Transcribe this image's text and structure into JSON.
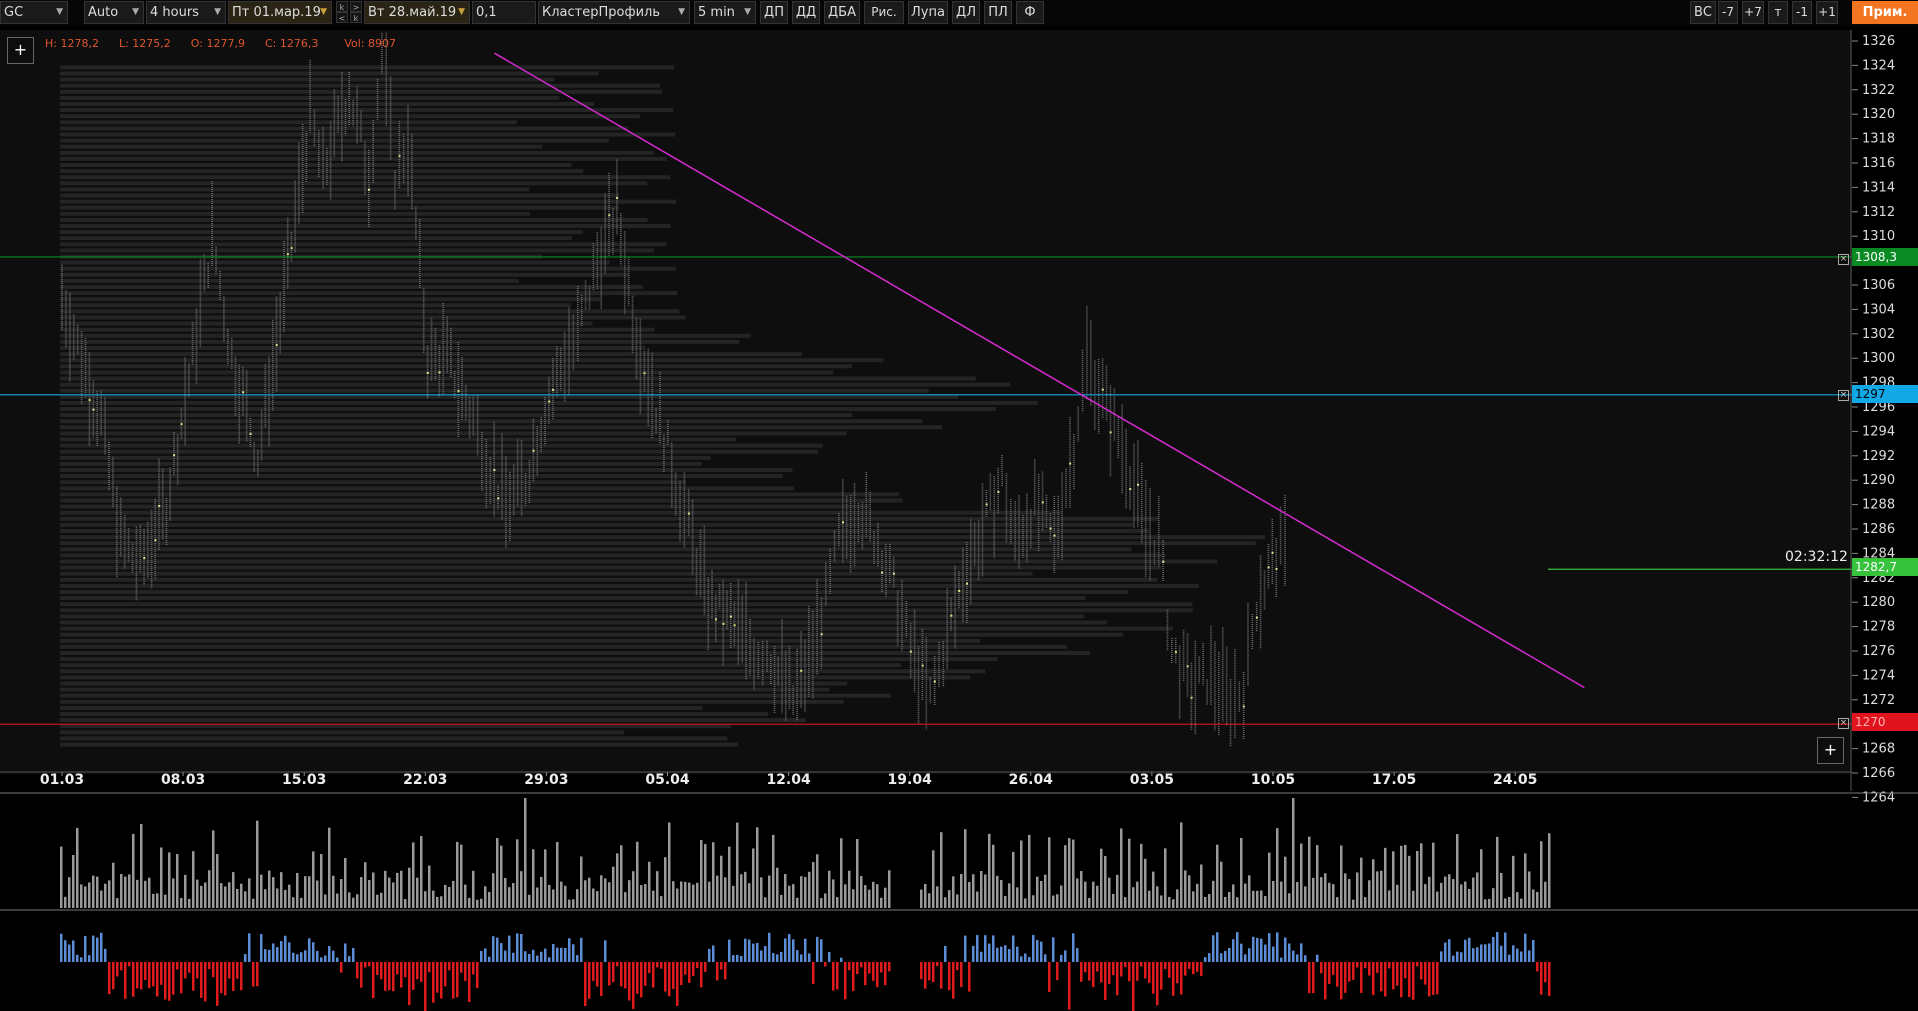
{
  "toolbar": {
    "symbol": "GC",
    "scale_mode": "Auto",
    "timeframe": "4 hours",
    "date_from": "Пт 01.мар.19",
    "date_to": "Вт 28.май.19",
    "tick_size": "0,1",
    "chart_type": "КластерПрофиль",
    "cluster_period": "5 min",
    "btn_dp": "ДП",
    "btn_dd": "ДД",
    "btn_dba": "ДБА",
    "btn_draw": "Рис.",
    "btn_zoom": "Лупа",
    "btn_dl": "ДЛ",
    "btn_pl": "ПЛ",
    "btn_f": "Ф",
    "btn_vs": "ВС",
    "btn_minus7": "-7",
    "btn_plus7": "+7",
    "btn_t": "т",
    "btn_minus1": "-1",
    "btn_plus1": "+1",
    "btn_apply": "Прим.",
    "spin_up": "k",
    "spin_down": "<",
    "spin2_up": ">",
    "spin2_down": "k"
  },
  "ohlc": {
    "high": "H: 1278,2",
    "low": "L: 1275,2",
    "open": "O: 1277,9",
    "close": "C: 1276,3",
    "volume": "Vol: 8907"
  },
  "price_labels": {
    "green_level": "1308,3",
    "blue_level": "1297",
    "current": "1282,7",
    "red_level": "1270",
    "timer": "02:32:12"
  },
  "colors": {
    "green_level": "#0a8a22",
    "blue_level": "#12a8e6",
    "current": "#37c23c",
    "red_level": "#e0141e",
    "trendline": "#d62bd0",
    "up_delta": "#5b8ed6",
    "down_delta": "#e01b1b",
    "volume": "#9a9a9a"
  },
  "chart_data": {
    "type": "bar",
    "price_axis": {
      "ticks": [
        1326,
        1324,
        1322,
        1320,
        1318,
        1316,
        1314,
        1312,
        1310,
        1308,
        1306,
        1304,
        1302,
        1300,
        1298,
        1296,
        1294,
        1292,
        1290,
        1288,
        1286,
        1284,
        1282,
        1280,
        1278,
        1276,
        1274,
        1272,
        1270,
        1268,
        1266,
        1264
      ],
      "range": [
        1265,
        1327
      ]
    },
    "date_labels": [
      "01.03",
      "08.03",
      "15.03",
      "22.03",
      "29.03",
      "05.04",
      "12.04",
      "19.04",
      "26.04",
      "03.05",
      "10.05",
      "17.05",
      "24.05"
    ],
    "levels": [
      {
        "name": "green_level",
        "price": 1308.3
      },
      {
        "name": "blue_level",
        "price": 1297
      },
      {
        "name": "current",
        "price": 1282.7
      },
      {
        "name": "red_level",
        "price": 1270
      }
    ],
    "trendline": {
      "start": [
        "2019-03-26",
        1325
      ],
      "end": [
        "2019-05-28",
        1273
      ]
    },
    "price_path": [
      [
        0,
        1305
      ],
      [
        6,
        1295
      ],
      [
        9,
        1285
      ],
      [
        12,
        1283
      ],
      [
        16,
        1288
      ],
      [
        20,
        1300
      ],
      [
        23,
        1310
      ],
      [
        26,
        1300
      ],
      [
        30,
        1292
      ],
      [
        34,
        1305
      ],
      [
        38,
        1320
      ],
      [
        40,
        1315
      ],
      [
        44,
        1322
      ],
      [
        47,
        1315
      ],
      [
        49,
        1325
      ],
      [
        51,
        1315
      ],
      [
        53,
        1318
      ],
      [
        56,
        1300
      ],
      [
        59,
        1300
      ],
      [
        63,
        1295
      ],
      [
        65,
        1292
      ],
      [
        68,
        1288
      ],
      [
        71,
        1290
      ],
      [
        74,
        1296
      ],
      [
        77,
        1300
      ],
      [
        79,
        1302
      ],
      [
        82,
        1308
      ],
      [
        85,
        1312
      ],
      [
        88,
        1302
      ],
      [
        91,
        1296
      ],
      [
        94,
        1290
      ],
      [
        96,
        1286
      ],
      [
        99,
        1280
      ],
      [
        103,
        1278
      ],
      [
        106,
        1276
      ],
      [
        108,
        1276
      ],
      [
        112,
        1272
      ],
      [
        115,
        1276
      ],
      [
        117,
        1280
      ],
      [
        119,
        1285
      ],
      [
        122,
        1288
      ],
      [
        125,
        1285
      ],
      [
        128,
        1280
      ],
      [
        130,
        1276
      ],
      [
        133,
        1272
      ],
      [
        135,
        1276
      ],
      [
        138,
        1282
      ],
      [
        141,
        1286
      ],
      [
        144,
        1290
      ],
      [
        146,
        1285
      ],
      [
        149,
        1288
      ],
      [
        152,
        1285
      ],
      [
        155,
        1293
      ],
      [
        157,
        1300
      ],
      [
        160,
        1296
      ],
      [
        163,
        1292
      ],
      [
        166,
        1286
      ],
      [
        168,
        1285
      ],
      [
        170,
        1276
      ],
      [
        173,
        1273
      ],
      [
        176,
        1274
      ],
      [
        179,
        1272
      ],
      [
        181,
        1273
      ],
      [
        183,
        1280
      ],
      [
        186,
        1284
      ],
      [
        188,
        1284
      ]
    ]
  }
}
